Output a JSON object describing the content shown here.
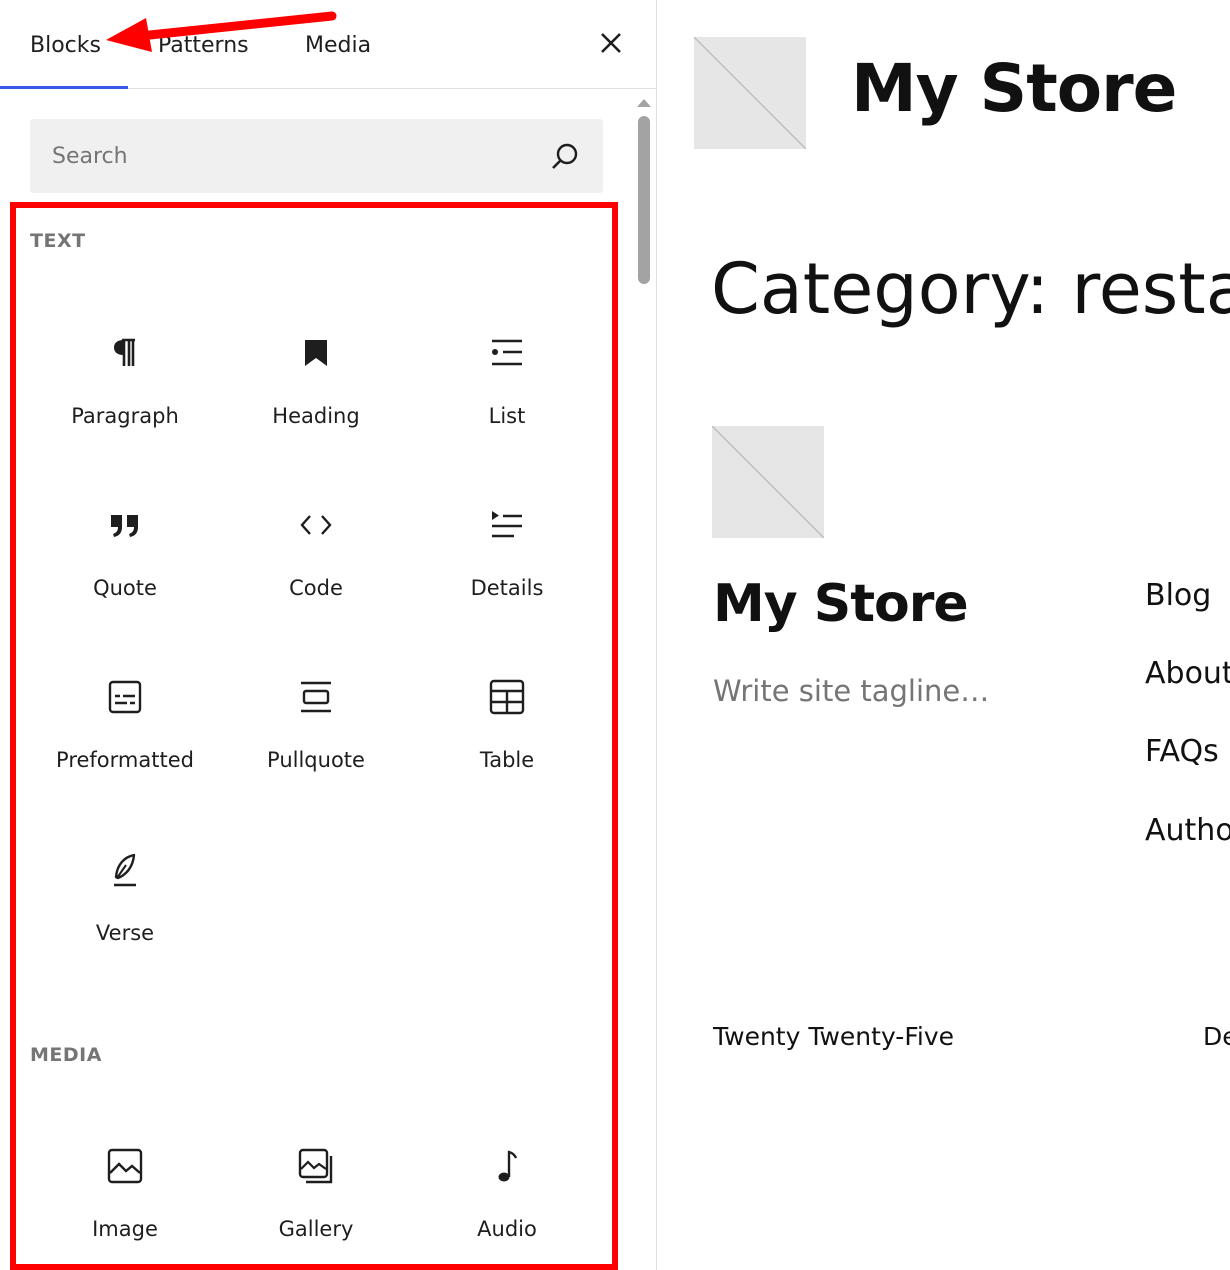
{
  "inserter": {
    "tabs": [
      {
        "label": "Blocks"
      },
      {
        "label": "Patterns"
      },
      {
        "label": "Media"
      }
    ],
    "close_icon": "close-icon",
    "search": {
      "placeholder": "Search",
      "value": "",
      "icon": "search-icon"
    },
    "sections": [
      {
        "title": "TEXT",
        "blocks": [
          {
            "label": "Paragraph",
            "icon": "paragraph-icon"
          },
          {
            "label": "Heading",
            "icon": "heading-icon"
          },
          {
            "label": "List",
            "icon": "list-icon"
          },
          {
            "label": "Quote",
            "icon": "quote-icon"
          },
          {
            "label": "Code",
            "icon": "code-icon"
          },
          {
            "label": "Details",
            "icon": "details-icon"
          },
          {
            "label": "Preformatted",
            "icon": "preformatted-icon"
          },
          {
            "label": "Pullquote",
            "icon": "pullquote-icon"
          },
          {
            "label": "Table",
            "icon": "table-icon"
          },
          {
            "label": "Verse",
            "icon": "verse-icon"
          }
        ]
      },
      {
        "title": "MEDIA",
        "blocks": [
          {
            "label": "Image",
            "icon": "image-icon"
          },
          {
            "label": "Gallery",
            "icon": "gallery-icon"
          },
          {
            "label": "Audio",
            "icon": "audio-icon"
          }
        ]
      }
    ],
    "active_tab_color": "#3858e9",
    "highlight_color": "#ff0000",
    "annotation_arrow_color": "#ff0000"
  },
  "preview": {
    "site_title": "My Store",
    "category_heading": "Category: restar",
    "footer_site_title": "My Store",
    "tagline": "Write site tagline…",
    "nav": [
      "Blog",
      "About",
      "FAQs",
      "Autho"
    ],
    "footer_theme": "Twenty Twenty-Five",
    "footer_right": "De"
  }
}
